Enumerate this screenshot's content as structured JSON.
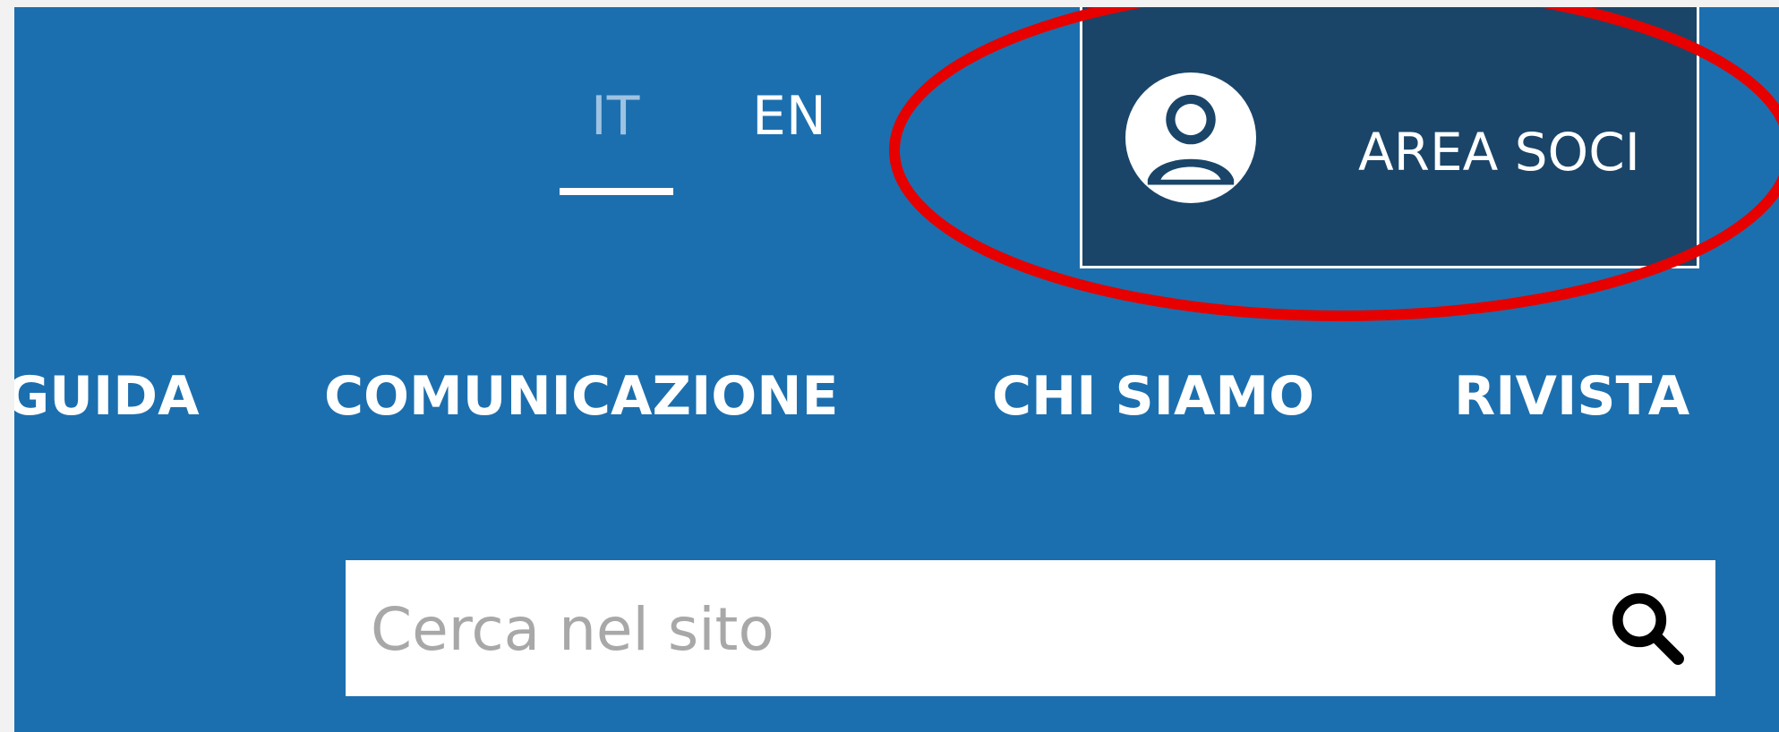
{
  "language_switcher": {
    "items": [
      {
        "label": "IT",
        "active": true
      },
      {
        "label": "EN",
        "active": false
      }
    ]
  },
  "account": {
    "label": "AREA SOCI",
    "icon": "user-icon"
  },
  "nav": {
    "items": [
      {
        "label": "GUIDA"
      },
      {
        "label": "COMUNICAZIONE"
      },
      {
        "label": "CHI SIAMO"
      },
      {
        "label": "RIVISTA"
      }
    ]
  },
  "search": {
    "placeholder": "Cerca nel sito",
    "value": "",
    "icon": "search-icon"
  },
  "colors": {
    "header_bg": "#1c6fae",
    "account_bg": "#1a4568",
    "active_lang": "#9ec3e2",
    "highlight": "#e60000"
  }
}
